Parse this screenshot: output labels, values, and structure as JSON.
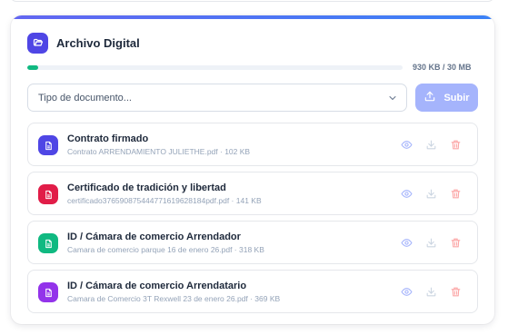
{
  "header": {
    "title": "Archivo Digital"
  },
  "storage": {
    "usage_text": "930 KB / 30 MB",
    "used_fraction": 0.03
  },
  "upload": {
    "select_placeholder": "Tipo de documento...",
    "button_label": "Subir"
  },
  "documents": [
    {
      "title": "Contrato firmado",
      "meta": "Contrato ARRENDAMIENTO JULIETHE.pdf · 102 KB",
      "color": "#4f46e5"
    },
    {
      "title": "Certificado de tradición y libertad",
      "meta": "certificado3765908754447716196281​84pdf.pdf · 141 KB",
      "color": "#e11d48"
    },
    {
      "title": "ID / Cámara de comercio Arrendador",
      "meta": "Camara de comercio parque 16 de enero 26.pdf · 318 KB",
      "color": "#10b981"
    },
    {
      "title": "ID / Cámara de comercio Arrendatario",
      "meta": "Camara de Comercio 3T Rexwell 23 de enero 26.pdf · 369 KB",
      "color": "#9333ea"
    }
  ],
  "colors": {
    "accent": "#6366f1",
    "progress": "#10b981",
    "upload_button": "#a5b4fc"
  }
}
